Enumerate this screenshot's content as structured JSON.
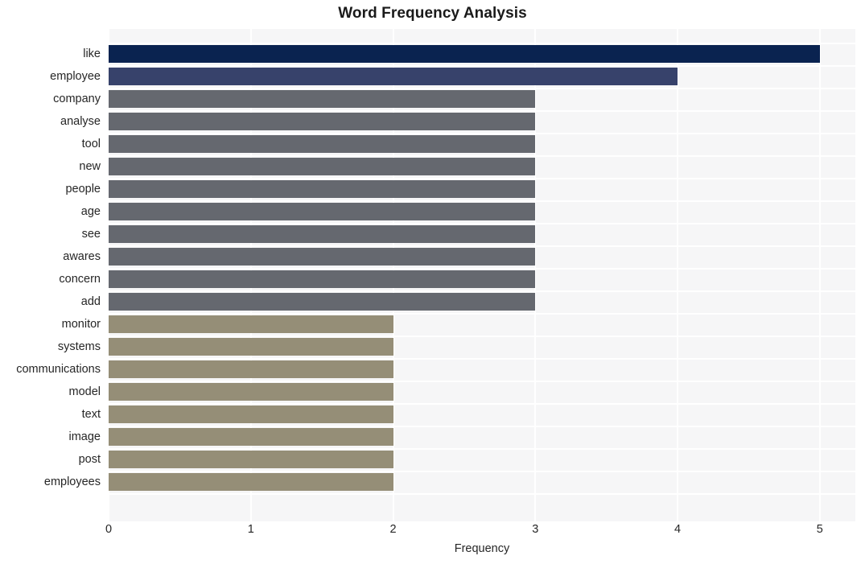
{
  "chart_data": {
    "type": "bar",
    "orientation": "horizontal",
    "title": "Word Frequency Analysis",
    "xlabel": "Frequency",
    "ylabel": "",
    "xlim": [
      0,
      5.25
    ],
    "xticks": [
      "0",
      "1",
      "2",
      "3",
      "4",
      "5"
    ],
    "xtick_values": [
      0,
      1,
      2,
      3,
      4,
      5
    ],
    "grid": true,
    "legend": "none",
    "categories": [
      "like",
      "employee",
      "company",
      "analyse",
      "tool",
      "new",
      "people",
      "age",
      "see",
      "awares",
      "concern",
      "add",
      "monitor",
      "systems",
      "communications",
      "model",
      "text",
      "image",
      "post",
      "employees"
    ],
    "values": [
      5,
      4,
      3,
      3,
      3,
      3,
      3,
      3,
      3,
      3,
      3,
      3,
      2,
      2,
      2,
      2,
      2,
      2,
      2,
      2
    ],
    "bar_colors": [
      "#0a2350",
      "#37426b",
      "#65686f",
      "#65686f",
      "#65686f",
      "#65686f",
      "#65686f",
      "#65686f",
      "#65686f",
      "#65686f",
      "#65686f",
      "#65686f",
      "#958e77",
      "#958e77",
      "#958e77",
      "#958e77",
      "#958e77",
      "#958e77",
      "#958e77",
      "#958e77",
      "#958e77"
    ],
    "palette": {
      "rank_1": "#0a2350",
      "rank_2": "#37426b",
      "rank_3": "#65686f",
      "rank_4": "#958e77"
    },
    "plot_background": "#f6f6f7",
    "gridline_color": "#ffffff",
    "page_background": "#ffffff"
  }
}
